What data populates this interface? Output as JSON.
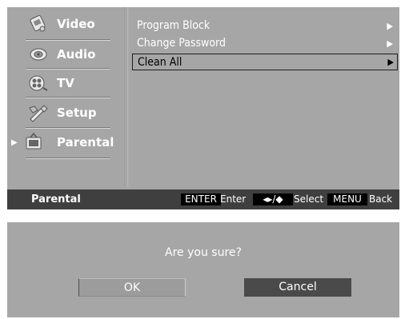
{
  "sidebar": {
    "items": [
      {
        "label": "Video",
        "icon": "video-icon"
      },
      {
        "label": "Audio",
        "icon": "audio-icon"
      },
      {
        "label": "TV",
        "icon": "tv-icon"
      },
      {
        "label": "Setup",
        "icon": "setup-icon"
      },
      {
        "label": "Parental",
        "icon": "parental-icon",
        "active": true,
        "marker": "▶"
      }
    ]
  },
  "menu": {
    "items": [
      {
        "label": "Program Block",
        "arrow": "▶"
      },
      {
        "label": "Change Password",
        "arrow": "▶"
      },
      {
        "label": "Clean All",
        "arrow": "▶",
        "selected": true
      }
    ]
  },
  "status_bar": {
    "title": "Parental",
    "enter_key": "ENTER",
    "enter_label": "Enter",
    "nav_key": "◂▸/◆",
    "nav_label": "Select",
    "menu_key": "MENU",
    "menu_label": "Back"
  },
  "dialog": {
    "message": "Are you sure?",
    "ok_label": "OK",
    "cancel_label": "Cancel"
  },
  "colors": {
    "panel": "#a6a6a6",
    "status_bar": "#3f3f3f",
    "key_bg": "#000000",
    "cancel_bg": "#4a4a4a",
    "text": "#ffffff"
  }
}
